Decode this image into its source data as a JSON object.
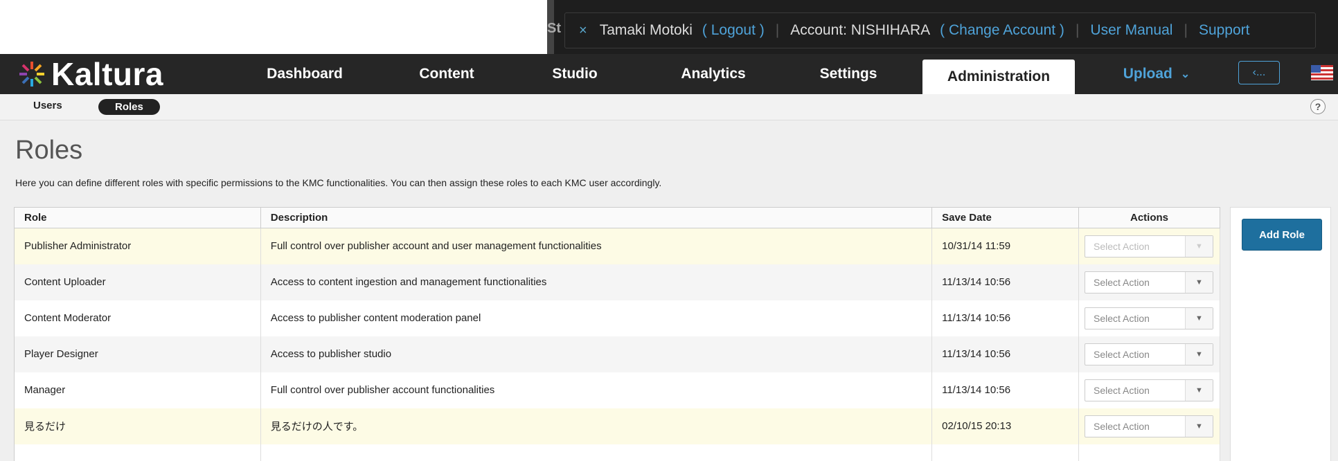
{
  "account_bar": {
    "partial_text": "St",
    "close_glyph": "×",
    "user_name": "Tamaki Motoki",
    "logout_label": "( Logout )",
    "account_label": "Account: NISHIHARA",
    "change_account_label": "( Change Account )",
    "user_manual_label": "User Manual",
    "support_label": "Support",
    "flag_icon": "us-flag-icon"
  },
  "nav": {
    "logo_text": "Kaltura",
    "items": [
      {
        "label": "Dashboard"
      },
      {
        "label": "Content"
      },
      {
        "label": "Studio"
      },
      {
        "label": "Analytics"
      },
      {
        "label": "Settings"
      },
      {
        "label": "Administration"
      }
    ],
    "upload_label": "Upload",
    "collapse_label": "‹...",
    "active_tab": "Administration"
  },
  "subnav": {
    "users_label": "Users",
    "roles_label": "Roles",
    "help_label": "?"
  },
  "page": {
    "title": "Roles",
    "description": "Here you can define different roles with specific permissions to the KMC functionalities. You can then assign these roles to each KMC user accordingly."
  },
  "table": {
    "columns": [
      "Role",
      "Description",
      "Save Date",
      "Actions"
    ],
    "rows": [
      {
        "role": "Publisher Administrator",
        "description": "Full control over publisher account and user management functionalities",
        "save_date": "10/31/14 11:59",
        "action": "Select Action",
        "disabled": true
      },
      {
        "role": "Content Uploader",
        "description": "Access to content ingestion and management functionalities",
        "save_date": "11/13/14 10:56",
        "action": "Select Action",
        "disabled": false
      },
      {
        "role": "Content Moderator",
        "description": "Access to publisher content moderation panel",
        "save_date": "11/13/14 10:56",
        "action": "Select Action",
        "disabled": false
      },
      {
        "role": "Player Designer",
        "description": "Access to publisher studio",
        "save_date": "11/13/14 10:56",
        "action": "Select Action",
        "disabled": false
      },
      {
        "role": "Manager",
        "description": "Full control over publisher account functionalities",
        "save_date": "11/13/14 10:56",
        "action": "Select Action",
        "disabled": false
      },
      {
        "role": "見るだけ",
        "description": "見るだけの人です。",
        "save_date": "02/10/15 20:13",
        "action": "Select Action",
        "disabled": false
      }
    ]
  },
  "side": {
    "add_role_label": "Add Role"
  },
  "colors": {
    "link": "#4fa3d9",
    "nav_bg": "#262626",
    "highlight_row": "#fdfbe5",
    "add_button": "#1e6f9e"
  }
}
